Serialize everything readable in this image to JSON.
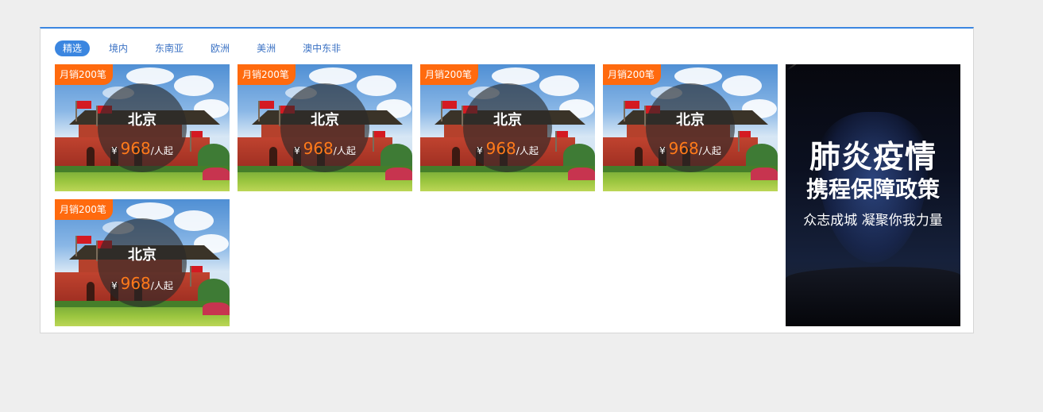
{
  "tabs": [
    {
      "label": "精选",
      "active": true
    },
    {
      "label": "境内",
      "active": false
    },
    {
      "label": "东南亚",
      "active": false
    },
    {
      "label": "欧洲",
      "active": false
    },
    {
      "label": "美洲",
      "active": false
    },
    {
      "label": "澳中东非",
      "active": false
    }
  ],
  "cards": [
    {
      "badge": "月销200笔",
      "city": "北京",
      "currency": "¥",
      "price": "968",
      "unit": "/人起"
    },
    {
      "badge": "月销200笔",
      "city": "北京",
      "currency": "¥",
      "price": "968",
      "unit": "/人起"
    },
    {
      "badge": "月销200笔",
      "city": "北京",
      "currency": "¥",
      "price": "968",
      "unit": "/人起"
    },
    {
      "badge": "月销200笔",
      "city": "北京",
      "currency": "¥",
      "price": "968",
      "unit": "/人起"
    },
    {
      "badge": "月销200笔",
      "city": "北京",
      "currency": "¥",
      "price": "968",
      "unit": "/人起"
    }
  ],
  "ad": {
    "title_line1": "肺炎疫情",
    "title_line2": "携程保障政策",
    "subtitle": "众志成城 凝聚你我力量"
  },
  "colors": {
    "accent": "#3b86e0",
    "badge": "#ff6a0e",
    "price": "#ff7a1a"
  }
}
